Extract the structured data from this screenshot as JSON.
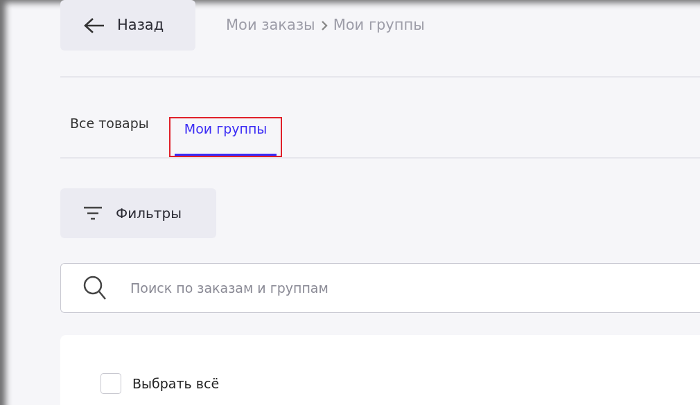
{
  "back_button": {
    "label": "Назад"
  },
  "breadcrumbs": [
    {
      "label": "Мои заказы"
    },
    {
      "label": "Мои группы"
    }
  ],
  "tabs": [
    {
      "label": "Все товары",
      "selected": false
    },
    {
      "label": "Мои группы",
      "selected": true
    }
  ],
  "filter_button": {
    "label": "Фильтры"
  },
  "search": {
    "placeholder": "Поиск по заказам и группам"
  },
  "select_all": {
    "label": "Выбрать всё",
    "checked": false
  }
}
